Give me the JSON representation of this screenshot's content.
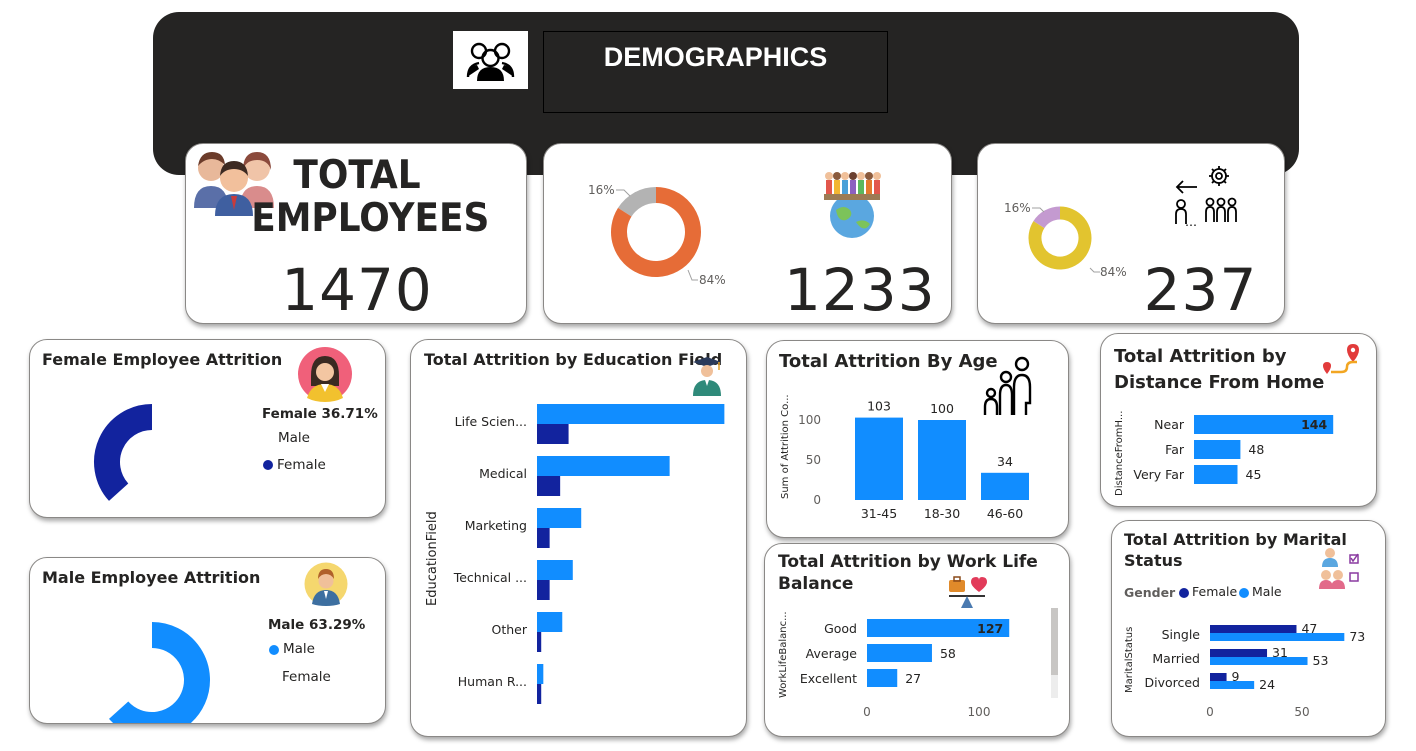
{
  "header": {
    "title": "DEMOGRAPHICS",
    "icon": "people-group-icon"
  },
  "kpi_total": {
    "title_line1": "TOTAL",
    "title_line2": "EMPLOYEES",
    "value": "1470",
    "icon": "employees-icon"
  },
  "kpi_retained": {
    "value": "1233",
    "icon": "diverse-people-globe-icon",
    "donut": {
      "small_label": "16%",
      "large_label": "84%",
      "small_pct": 0.16,
      "colors": {
        "large": "#e66c37",
        "small": "#b3b3b3"
      }
    }
  },
  "kpi_attrition": {
    "value": "237",
    "icon": "people-leaving-icon",
    "donut": {
      "small_label": "16%",
      "large_label": "84%",
      "small_pct": 0.16,
      "colors": {
        "large": "#e2c42f",
        "small": "#c49ad0"
      }
    }
  },
  "female_attrition": {
    "title": "Female Employee Attrition",
    "pct_label": "Female 36.71%",
    "legend": [
      "Male",
      "Female"
    ],
    "fraction": 0.3671,
    "color": "#12239e"
  },
  "male_attrition": {
    "title": "Male Employee Attrition",
    "pct_label": "Male 63.29%",
    "legend": [
      "Male",
      "Female"
    ],
    "fraction": 0.6329,
    "color": "#118dff"
  },
  "education_chart": {
    "title": "Total Attrition by Education Field",
    "ylabel": "EducationField",
    "categories": [
      "Life Scien...",
      "Medical",
      "Marketing",
      "Technical ...",
      "Other",
      "Human R..."
    ],
    "series": [
      {
        "values": [
          89,
          63,
          21,
          17,
          12,
          3
        ],
        "color": "#118dff"
      },
      {
        "values": [
          15,
          11,
          6,
          6,
          2,
          2
        ],
        "color": "#12239e"
      }
    ],
    "xlim": [
      0,
      95
    ]
  },
  "age_chart": {
    "title": "Total Attrition By Age",
    "ylabel": "Sum of Attrition Co...",
    "categories": [
      "31-45",
      "18-30",
      "46-60"
    ],
    "values": [
      103,
      100,
      34
    ],
    "yticks": [
      "0",
      "50",
      "100"
    ],
    "ylim": [
      0,
      110
    ],
    "color": "#118dff"
  },
  "distance_chart": {
    "title_line1": "Total Attrition by",
    "title_line2": "Distance From Home",
    "ylabel": "DistanceFromH...",
    "categories": [
      "Near",
      "Far",
      "Very Far"
    ],
    "values": [
      144,
      48,
      45
    ],
    "value_labels": [
      "144",
      "48",
      "45"
    ],
    "xlim": [
      0,
      150
    ],
    "color": "#118dff"
  },
  "worklife_chart": {
    "title_line1": "Total Attrition by Work Life",
    "title_line2": "Balance",
    "ylabel": "WorkLifeBalanc...",
    "categories": [
      "Good",
      "Average",
      "Excellent"
    ],
    "values": [
      127,
      58,
      27
    ],
    "value_labels": [
      "127",
      "58",
      "27"
    ],
    "xticks": [
      "0",
      "100"
    ],
    "xlim": [
      0,
      140
    ],
    "color": "#118dff"
  },
  "marital_chart": {
    "title_line1": "Total Attrition by Marital",
    "title_line2": "Status",
    "legend_title": "Gender",
    "legend": [
      "Female",
      "Male"
    ],
    "ylabel": "MaritalStatus",
    "categories": [
      "Single",
      "Married",
      "Divorced"
    ],
    "series": [
      {
        "name": "Female",
        "values": [
          47,
          31,
          9
        ],
        "color": "#12239e"
      },
      {
        "name": "Male",
        "values": [
          73,
          53,
          24
        ],
        "color": "#118dff"
      }
    ],
    "xticks": [
      "0",
      "50"
    ],
    "xlim": [
      0,
      80
    ]
  }
}
